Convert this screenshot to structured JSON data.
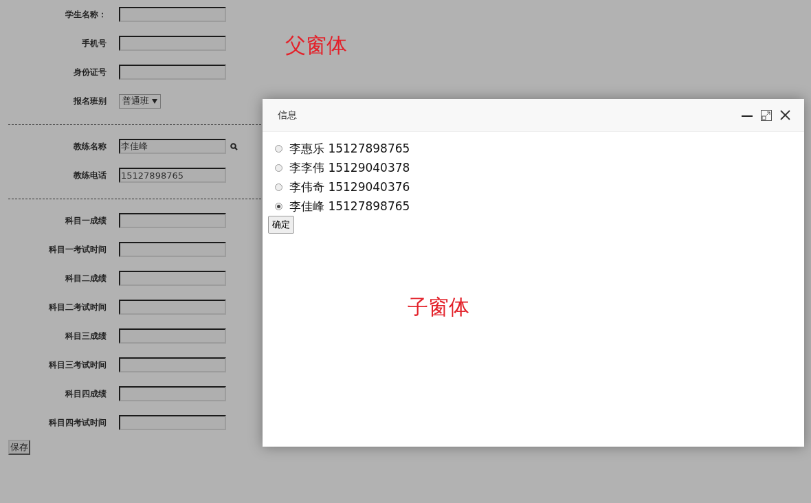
{
  "parent_label": "父窗体",
  "form": {
    "sections": [
      {
        "fields": [
          {
            "kind": "text",
            "label": "学生名称："
          },
          {
            "kind": "text",
            "label": "手机号"
          },
          {
            "kind": "text",
            "label": "身份证号"
          },
          {
            "kind": "select",
            "label": "报名班别",
            "value": "普通班"
          }
        ]
      },
      {
        "fields": [
          {
            "kind": "lookup",
            "label": "教练名称",
            "value": "李佳峰"
          },
          {
            "kind": "text",
            "label": "教练电话",
            "value": "15127898765"
          }
        ]
      },
      {
        "fields": [
          {
            "kind": "text",
            "label": "科目一成绩"
          },
          {
            "kind": "text",
            "label": "科目一考试时间"
          },
          {
            "kind": "text",
            "label": "科目二成绩"
          },
          {
            "kind": "text",
            "label": "科目二考试时间"
          },
          {
            "kind": "text",
            "label": "科目三成绩"
          },
          {
            "kind": "text",
            "label": "科目三考试时间"
          },
          {
            "kind": "text",
            "label": "科目四成绩"
          },
          {
            "kind": "text",
            "label": "科目四考试时间"
          }
        ]
      }
    ],
    "save_button": "保存"
  },
  "dialog": {
    "title": "信息",
    "options": [
      {
        "label": "李惠乐 15127898765",
        "selected": false
      },
      {
        "label": "李李伟 15129040378",
        "selected": false
      },
      {
        "label": "李伟奇 15129040376",
        "selected": false
      },
      {
        "label": "李佳峰 15127898765",
        "selected": true
      }
    ],
    "confirm_button": "确定",
    "child_label": "子窗体"
  }
}
